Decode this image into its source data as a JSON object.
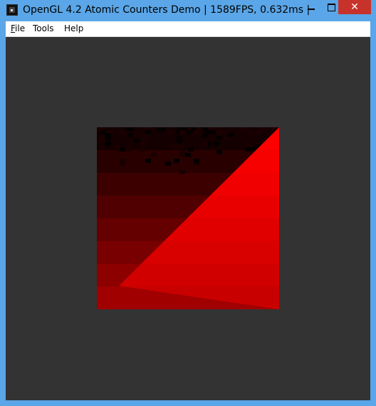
{
  "window": {
    "title": "OpenGL 4.2 Atomic Counters Demo | 1589FPS, 0.632ms | ...",
    "icon": "app-icon",
    "controls": {
      "minimize": "minimize-icon",
      "maximize": "maximize-icon",
      "close": "close-icon",
      "close_glyph": "✕"
    }
  },
  "menu": {
    "file": {
      "key": "F",
      "rest": "ile"
    },
    "tools": "Tools",
    "help": "Help"
  },
  "colors": {
    "titlebar": "#5aa6e8",
    "client_bg": "#333333",
    "close_red": "#c7322a",
    "quad_red": "#ff0000"
  }
}
